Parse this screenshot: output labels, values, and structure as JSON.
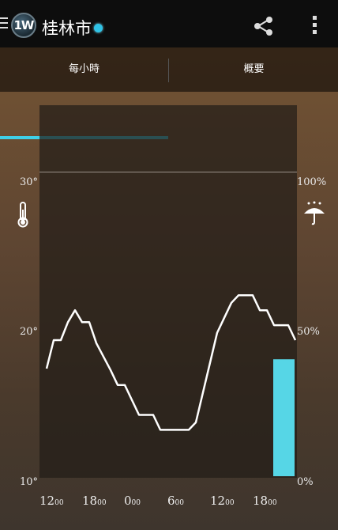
{
  "app": {
    "logo_text": "1W",
    "city": "桂林市"
  },
  "tabs": [
    {
      "label": "每小時",
      "active": true
    },
    {
      "label": "概要",
      "active": false
    }
  ],
  "colors": {
    "accent": "#3fd0e8",
    "precip_bar": "#56d6e6",
    "line": "#ffffff"
  },
  "icons": {
    "menu": "menu-icon",
    "share": "share-icon",
    "more": "more-vert-icon",
    "thermometer": "thermometer-icon",
    "rain": "umbrella-rain-icon"
  },
  "chart_data": {
    "type": "line",
    "x_ticks": [
      {
        "hour": "12",
        "min": "00"
      },
      {
        "hour": "18",
        "min": "00"
      },
      {
        "hour": "0",
        "min": "00"
      },
      {
        "hour": "6",
        "min": "00"
      },
      {
        "hour": "12",
        "min": "00"
      },
      {
        "hour": "18",
        "min": "00"
      }
    ],
    "left_axis": {
      "ticks": [
        "30°",
        "20°",
        "10°"
      ],
      "range": [
        10,
        35
      ]
    },
    "right_axis": {
      "ticks": [
        "100%",
        "50%",
        "0%"
      ],
      "range": [
        0,
        100
      ]
    },
    "temperature_hourly": [
      17.2,
      19.1,
      19.1,
      20.3,
      21.1,
      20.3,
      20.3,
      18.9,
      18.0,
      17.1,
      16.1,
      16.1,
      15.1,
      14.1,
      14.1,
      14.1,
      13.1,
      13.1,
      13.1,
      13.1,
      13.1,
      13.6,
      15.6,
      17.6,
      19.6,
      20.6,
      21.6,
      22.1,
      22.1,
      22.1,
      21.1,
      21.1,
      20.1,
      20.1,
      20.1,
      19.1
    ],
    "precip_bar": {
      "hour_start": 32,
      "hour_end": 35,
      "value_pct": 41
    }
  }
}
